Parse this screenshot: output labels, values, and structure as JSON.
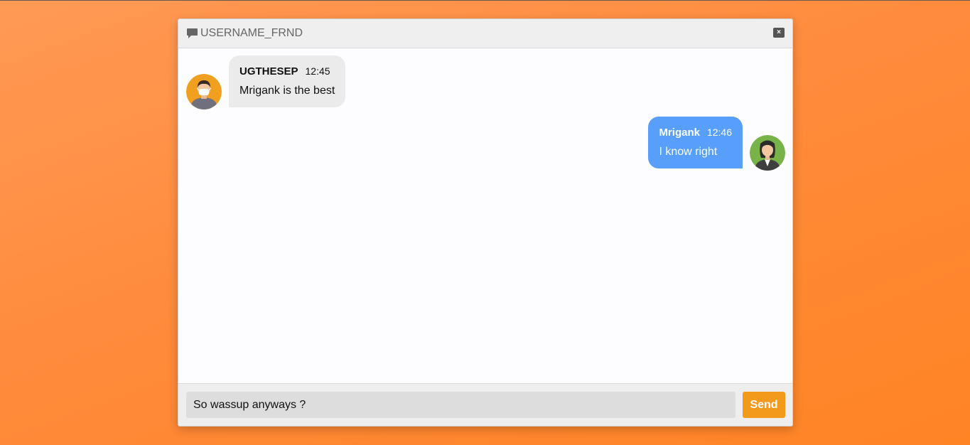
{
  "chat": {
    "title": "USERNAME_FRND",
    "close_label": "×",
    "header_icon": "chat-bubble-icon"
  },
  "messages": [
    {
      "side": "left",
      "name": "UGTHESEP",
      "time": "12:45",
      "text": "Mrigank is the best",
      "avatar": "man-avatar-icon"
    },
    {
      "side": "right",
      "name": "Mrigank",
      "time": "12:46",
      "text": "I know right",
      "avatar": "woman-avatar-icon"
    }
  ],
  "composer": {
    "input_value": "So wassup anyways ?",
    "send_label": "Send"
  },
  "colors": {
    "background": "#ff8a3a",
    "outgoing_bubble": "#579ffb",
    "incoming_bubble": "#ebebeb",
    "send_button": "#f39a1c"
  }
}
